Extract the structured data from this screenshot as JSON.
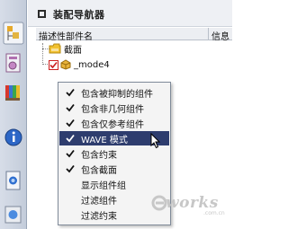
{
  "navigator": {
    "title": "装配导航器",
    "columns": [
      "描述性部件名",
      "信息"
    ]
  },
  "tree": {
    "items": [
      {
        "label": "截面",
        "icon": "section-folder-icon"
      },
      {
        "label": "_mode4",
        "icon": "assembly-part-icon"
      }
    ]
  },
  "context_menu": {
    "items": [
      {
        "label": "包含被抑制的组件",
        "checked": true
      },
      {
        "label": "包含非几何组件",
        "checked": true
      },
      {
        "label": "包含仅参考组件",
        "checked": true
      },
      {
        "label": "WAVE 模式",
        "checked": true,
        "highlighted": true
      },
      {
        "label": "包含约束",
        "checked": true
      },
      {
        "label": "包含截面",
        "checked": true
      },
      {
        "label": "显示组件组",
        "checked": false
      },
      {
        "label": "过滤组件",
        "checked": false
      },
      {
        "label": "过滤约束",
        "checked": false
      }
    ]
  },
  "sidebar": {
    "icons": [
      "assembly-navigator-icon",
      "part-navigator-icon",
      "reuse-library-icon",
      "help-info-icon",
      "history-icon",
      "system-materials-icon",
      "process-studio-icon"
    ]
  },
  "colors": {
    "menu_highlight": "#2e3d6e",
    "checkbox_red": "#cc1f1f",
    "folder_yellow": "#f2c230"
  },
  "watermark": {
    "logo": "e-works"
  }
}
